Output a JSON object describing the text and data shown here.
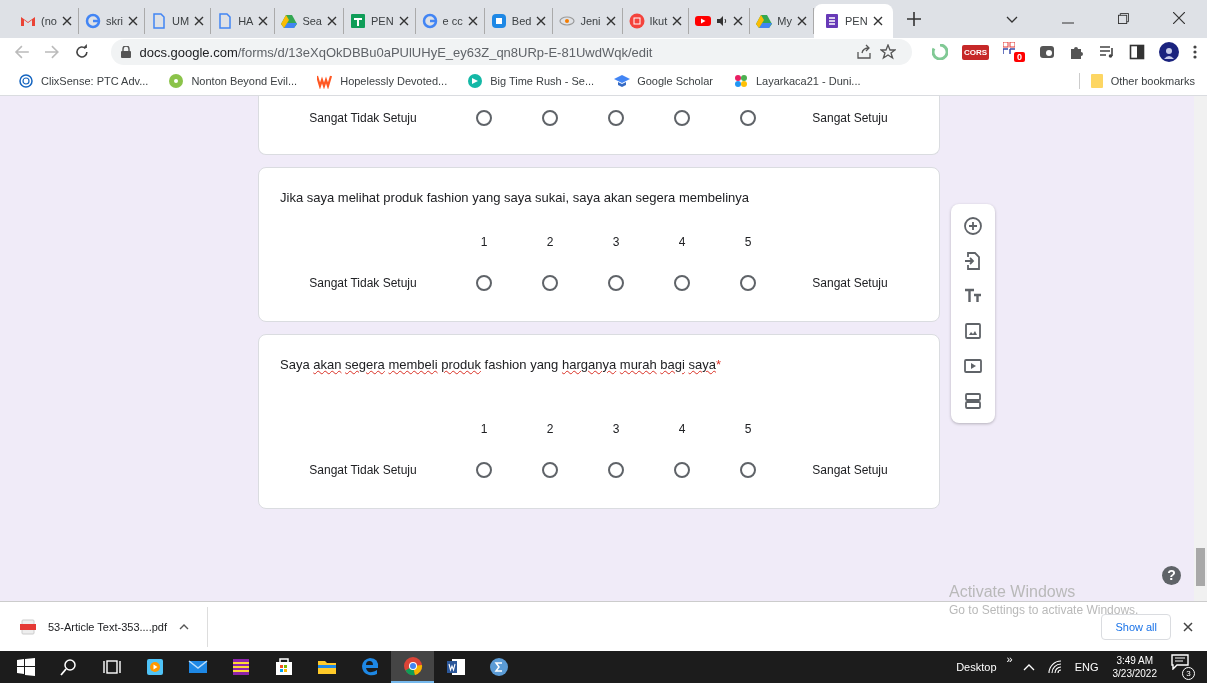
{
  "browser": {
    "tabs": [
      {
        "title": "(no",
        "selected": false
      },
      {
        "title": "skri",
        "selected": false
      },
      {
        "title": "UM",
        "selected": false
      },
      {
        "title": "HA",
        "selected": false
      },
      {
        "title": "Sea",
        "selected": false
      },
      {
        "title": "PEN",
        "selected": false
      },
      {
        "title": "e cc",
        "selected": false
      },
      {
        "title": "Bed",
        "selected": false
      },
      {
        "title": "Jeni",
        "selected": false
      },
      {
        "title": "Ikut",
        "selected": false
      },
      {
        "audio": true,
        "selected": false
      },
      {
        "title": "My",
        "selected": false
      },
      {
        "title": "PEN",
        "selected": true
      }
    ],
    "address": {
      "host": "docs.google.com",
      "path": "/forms/d/13eXqOkDBBu0aPUlUHyE_ey63Z_qn8URp-E-81UwdWqk/edit"
    },
    "extensions": [
      {
        "kind": "spinner"
      },
      {
        "kind": "cors",
        "label": "CORS"
      },
      {
        "kind": "ff",
        "badge": "0"
      },
      {
        "kind": "cast"
      },
      {
        "kind": "puzzle"
      },
      {
        "kind": "queue"
      },
      {
        "kind": "sidepanel"
      },
      {
        "kind": "avatar"
      }
    ],
    "bookmarks": [
      {
        "title": "ClixSense: PTC Adv..."
      },
      {
        "title": "Nonton Beyond Evil..."
      },
      {
        "title": "Hopelessly Devoted..."
      },
      {
        "title": "Big Time Rush - Se..."
      },
      {
        "title": "Google Scholar"
      },
      {
        "title": "Layarkaca21 - Duni..."
      }
    ],
    "other_bookmarks": "Other bookmarks"
  },
  "form": {
    "questions": [
      {
        "options": [
          {
            "selected": false
          },
          {
            "selected": false
          },
          {
            "selected": false
          },
          {
            "selected": false
          },
          {
            "selected": false
          }
        ],
        "low_label": "Sangat Tidak Setuju",
        "high_label": "Sangat Setuju"
      },
      {
        "title": [
          {
            "text": "Jika saya melihat produk fashion yang saya sukai, saya akan segera membelinya",
            "misspelled": false
          }
        ],
        "options": [
          {
            "label": "1",
            "selected": false
          },
          {
            "label": "2",
            "selected": false
          },
          {
            "label": "3",
            "selected": false
          },
          {
            "label": "4",
            "selected": false
          },
          {
            "label": "5",
            "selected": false
          }
        ],
        "low_label": "Sangat Tidak Setuju",
        "high_label": "Sangat Setuju"
      },
      {
        "title": [
          {
            "text": "Saya",
            "misspelled": false
          },
          {
            "text": "akan",
            "misspelled": true
          },
          {
            "text": "segera",
            "misspelled": true
          },
          {
            "text": "membeli",
            "misspelled": true
          },
          {
            "text": "produk",
            "misspelled": true
          },
          {
            "text": "fashion yang",
            "misspelled": false
          },
          {
            "text": "harganya",
            "misspelled": true
          },
          {
            "text": "murah",
            "misspelled": true
          },
          {
            "text": "bagi",
            "misspelled": true
          },
          {
            "text": "saya",
            "misspelled": true
          }
        ],
        "required_mark": "*",
        "options": [
          {
            "label": "1",
            "selected": false
          },
          {
            "label": "2",
            "selected": false
          },
          {
            "label": "3",
            "selected": false
          },
          {
            "label": "4",
            "selected": false
          },
          {
            "label": "5",
            "selected": false
          }
        ],
        "low_label": "Sangat Tidak Setuju",
        "high_label": "Sangat Setuju"
      }
    ],
    "toolbar": [
      {
        "kind": "add"
      },
      {
        "kind": "import"
      },
      {
        "kind": "text"
      },
      {
        "kind": "image"
      },
      {
        "kind": "video"
      },
      {
        "kind": "section"
      }
    ],
    "help": "?"
  },
  "activation": {
    "title": "Activate Windows",
    "text": "Go to Settings to activate Windows."
  },
  "downloads": {
    "file": "53-Article Text-353....pdf",
    "show_all": "Show all"
  },
  "taskbar": {
    "apps": [
      {
        "kind": "start",
        "selected": false
      },
      {
        "kind": "search",
        "selected": false
      },
      {
        "kind": "taskview",
        "selected": false
      },
      {
        "kind": "player",
        "selected": false
      },
      {
        "kind": "mail",
        "selected": false
      },
      {
        "kind": "archive",
        "selected": false
      },
      {
        "kind": "store",
        "selected": false
      },
      {
        "kind": "folder",
        "selected": false
      },
      {
        "kind": "edge",
        "selected": false
      },
      {
        "kind": "chrome",
        "selected": true
      },
      {
        "kind": "word",
        "selected": false
      },
      {
        "kind": "math",
        "selected": false
      }
    ],
    "desktop": "Desktop",
    "overflow": "»",
    "language": "ENG",
    "time": "3:49 AM",
    "date": "3/23/2022",
    "notifications": "3"
  }
}
